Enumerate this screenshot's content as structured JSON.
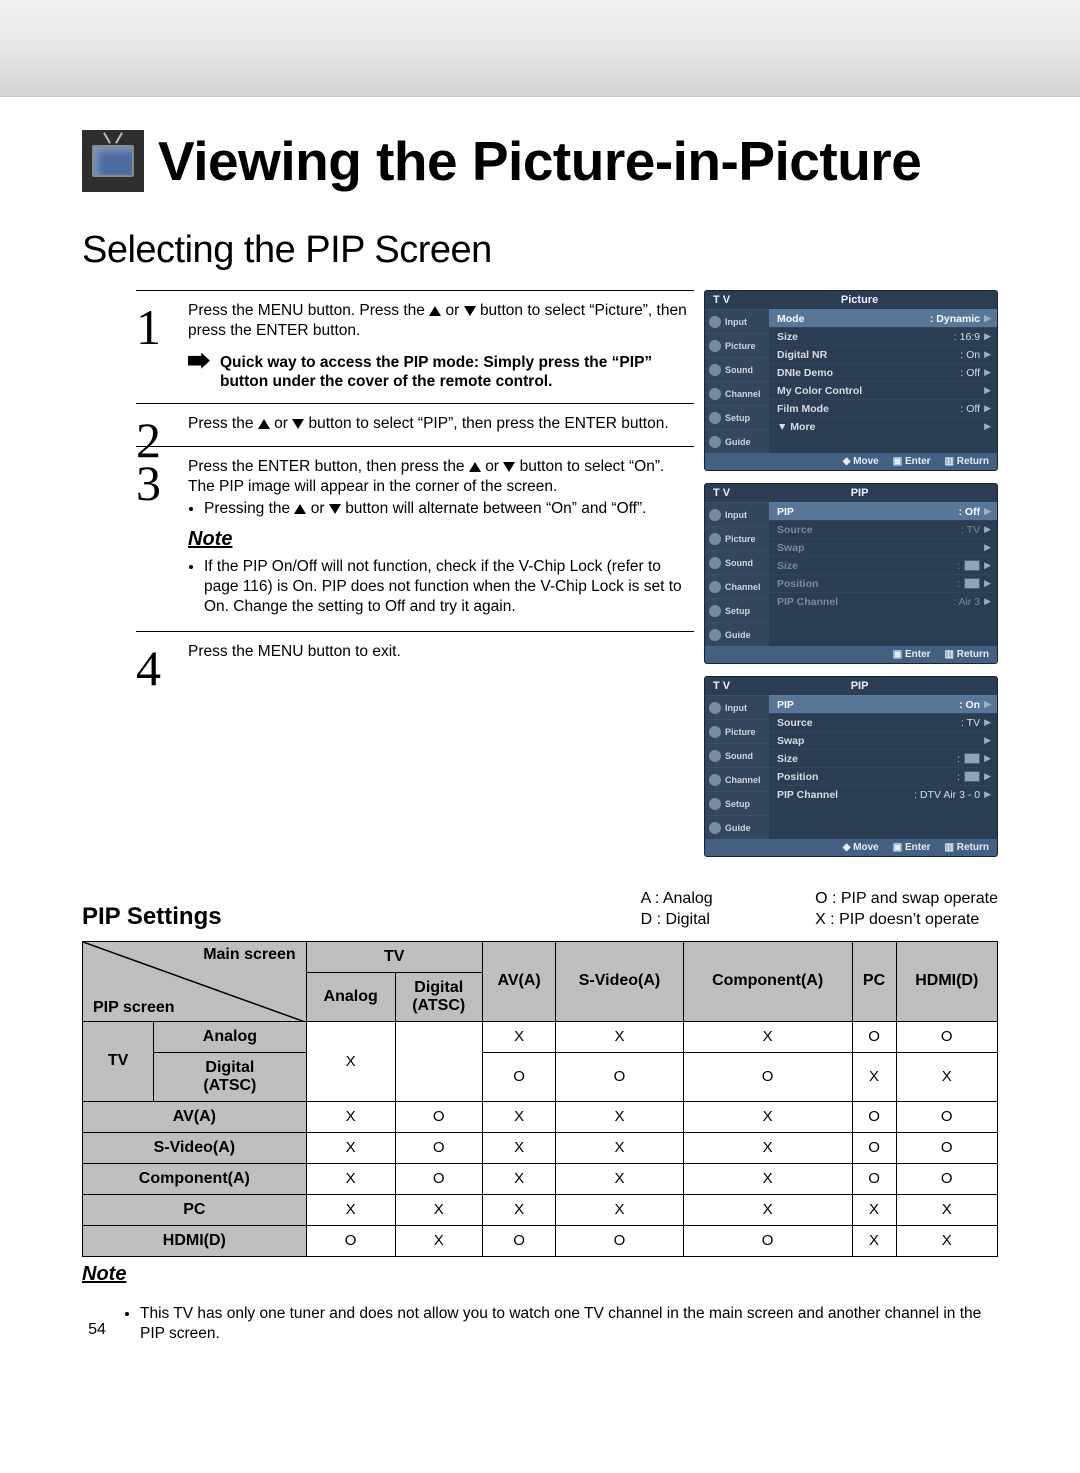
{
  "page_number": "54",
  "title": "Viewing the Picture-in-Picture",
  "subtitle": "Selecting the PIP Screen",
  "steps": {
    "s1": {
      "num": "1",
      "text_a": "Press the MENU button. Press the ",
      "text_b": " or ",
      "text_c": " button to select “Picture”, then press the ENTER button.",
      "hint": "Quick way to access the PIP mode: Simply press the “PIP” button under the cover of the remote control."
    },
    "s2": {
      "num": "2",
      "text_a": "Press the ",
      "text_b": " or ",
      "text_c": " button to select “PIP”, then press the ENTER button."
    },
    "s3": {
      "num": "3",
      "text_a": "Press the ENTER button, then press the ",
      "text_b": " or ",
      "text_c": " button to select “On”. The PIP image will appear in the corner of the screen.",
      "bullet1_a": "Pressing the ",
      "bullet1_b": " or ",
      "bullet1_c": " button will alternate between “On” and “Off”.",
      "note_label": "Note",
      "note_bullet": "If the PIP On/Off will not function, check if the V-Chip Lock (refer to page 116) is On. PIP does not function when the V-Chip Lock is set to On. Change the setting to Off and try it again."
    },
    "s4": {
      "num": "4",
      "text": "Press the MENU button to exit."
    }
  },
  "legend": {
    "A": "A : Analog",
    "D": "D : Digital",
    "O": "O : PIP and swap operate",
    "X": "X : PIP doesn’t operate"
  },
  "pip_heading": "PIP Settings",
  "osd": {
    "tv": "T V",
    "side": [
      "Input",
      "Picture",
      "Sound",
      "Channel",
      "Setup",
      "Guide"
    ],
    "foot_move": "Move",
    "foot_enter": "Enter",
    "foot_return": "Return",
    "menu1": {
      "title": "Picture",
      "rows": [
        {
          "k": "Mode",
          "v": ": Dynamic",
          "sel": true
        },
        {
          "k": "Size",
          "v": ": 16:9"
        },
        {
          "k": "Digital NR",
          "v": ": On"
        },
        {
          "k": "DNIe Demo",
          "v": ": Off"
        },
        {
          "k": "My Color Control",
          "v": ""
        },
        {
          "k": "Film Mode",
          "v": ": Off"
        },
        {
          "k": "▼ More",
          "v": ""
        }
      ]
    },
    "menu2": {
      "title": "PIP",
      "rows": [
        {
          "k": "PIP",
          "v": ": Off",
          "sel": true
        },
        {
          "k": "Source",
          "v": ": TV",
          "dim": true
        },
        {
          "k": "Swap",
          "v": "",
          "dim": true
        },
        {
          "k": "Size",
          "v": ":",
          "thumb": true,
          "dim": true
        },
        {
          "k": "Position",
          "v": ":",
          "thumb": true,
          "dim": true
        },
        {
          "k": "PIP Channel",
          "v": ": Air 3",
          "dim": true
        }
      ]
    },
    "menu3": {
      "title": "PIP",
      "rows": [
        {
          "k": "PIP",
          "v": ": On",
          "sel": true
        },
        {
          "k": "Source",
          "v": ": TV"
        },
        {
          "k": "Swap",
          "v": ""
        },
        {
          "k": "Size",
          "v": ":",
          "thumb": true
        },
        {
          "k": "Position",
          "v": ":",
          "thumb": true
        },
        {
          "k": "PIP Channel",
          "v": ": DTV Air 3 - 0"
        }
      ]
    }
  },
  "table": {
    "corner_top": "Main screen",
    "corner_bottom": "PIP screen",
    "tv_group": "TV",
    "cols": [
      "Analog",
      "Digital\n(ATSC)",
      "AV(A)",
      "S-Video(A)",
      "Component(A)",
      "PC",
      "HDMI(D)"
    ],
    "rows_tv_group": "TV",
    "row_labels": [
      "Analog",
      "Digital\n(ATSC)",
      "AV(A)",
      "S-Video(A)",
      "Component(A)",
      "PC",
      "HDMI(D)"
    ],
    "cells": [
      [
        "X",
        "",
        "X",
        "X",
        "X",
        "O",
        "O"
      ],
      [
        "",
        "",
        "O",
        "O",
        "O",
        "X",
        "X"
      ],
      [
        "X",
        "O",
        "X",
        "X",
        "X",
        "O",
        "O"
      ],
      [
        "X",
        "O",
        "X",
        "X",
        "X",
        "O",
        "O"
      ],
      [
        "X",
        "O",
        "X",
        "X",
        "X",
        "O",
        "O"
      ],
      [
        "X",
        "X",
        "X",
        "X",
        "X",
        "X",
        "X"
      ],
      [
        "O",
        "X",
        "O",
        "O",
        "O",
        "X",
        "X"
      ]
    ],
    "merged_2x1": "X"
  },
  "footnote_label": "Note",
  "footnote_text": "This TV has only one tuner and does not allow you to watch one TV channel in the main screen and another channel in the PIP screen."
}
